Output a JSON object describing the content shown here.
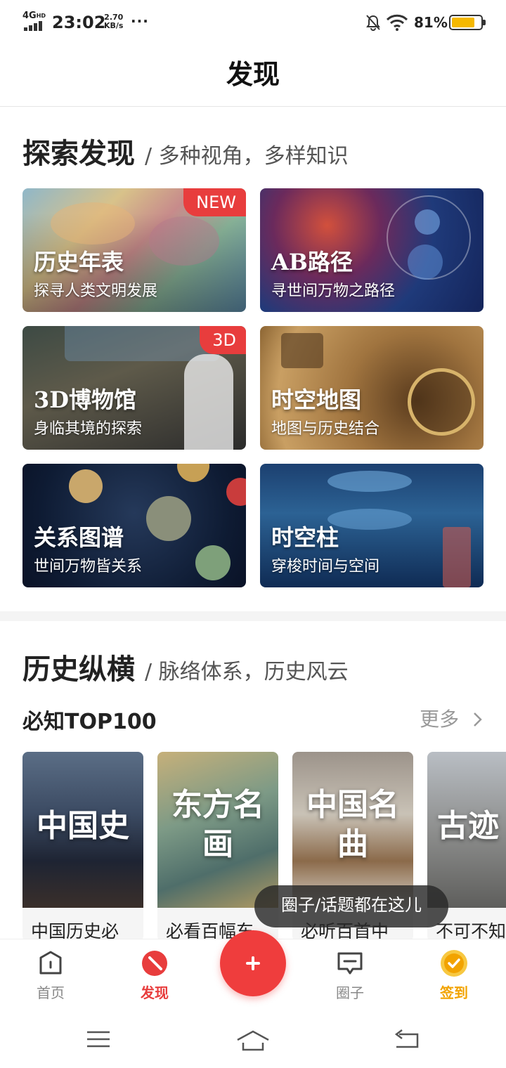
{
  "status_bar": {
    "network": "4G",
    "network_sup": "HD",
    "time": "23:02",
    "speed_value": "2.70",
    "speed_unit": "KB/s",
    "overflow": "···",
    "battery_pct": "81%",
    "battery_level": 0.81,
    "icons": [
      "signal-icon",
      "bell-off-icon",
      "wifi-icon",
      "battery-icon"
    ]
  },
  "header": {
    "title": "发现"
  },
  "explore": {
    "title": "探索发现",
    "subtitle": "/ 多种视角，多样知识",
    "cards": [
      {
        "title": "历史年表",
        "desc": "探寻人类文明发展",
        "badge": "NEW"
      },
      {
        "title": "AB路径",
        "desc": "寻世间万物之路径"
      },
      {
        "title": "3D博物馆",
        "desc": "身临其境的探索",
        "badge": "3D"
      },
      {
        "title": "时空地图",
        "desc": "地图与历史结合"
      },
      {
        "title": "关系图谱",
        "desc": "世间万物皆关系"
      },
      {
        "title": "时空柱",
        "desc": "穿梭时间与空间"
      }
    ]
  },
  "history": {
    "title": "历史纵横",
    "subtitle": "/ 脉络体系，历史风云",
    "top100_label": "必知TOP100",
    "more_label": "更多",
    "items": [
      {
        "cover_text": "中国史",
        "caption": "中国历史必"
      },
      {
        "cover_text": "东方名画",
        "caption": "必看百幅东"
      },
      {
        "cover_text": "中国名曲",
        "caption": "必听百首中"
      },
      {
        "cover_text": "古迹",
        "caption": "不可不知"
      }
    ]
  },
  "toast": "圈子/话题都在这儿",
  "tabbar": {
    "items": [
      {
        "label": "首页",
        "icon": "home-icon"
      },
      {
        "label": "发现",
        "icon": "compass-icon",
        "active": true
      },
      {
        "label": "",
        "icon": "plus-icon"
      },
      {
        "label": "圈子",
        "icon": "message-icon"
      },
      {
        "label": "签到",
        "icon": "checkin-icon"
      }
    ],
    "active_color": "#e83d3d",
    "checkin_color": "#f2a300"
  },
  "system_nav": {
    "icons": [
      "menu-icon",
      "home-outline-icon",
      "back-icon"
    ]
  }
}
